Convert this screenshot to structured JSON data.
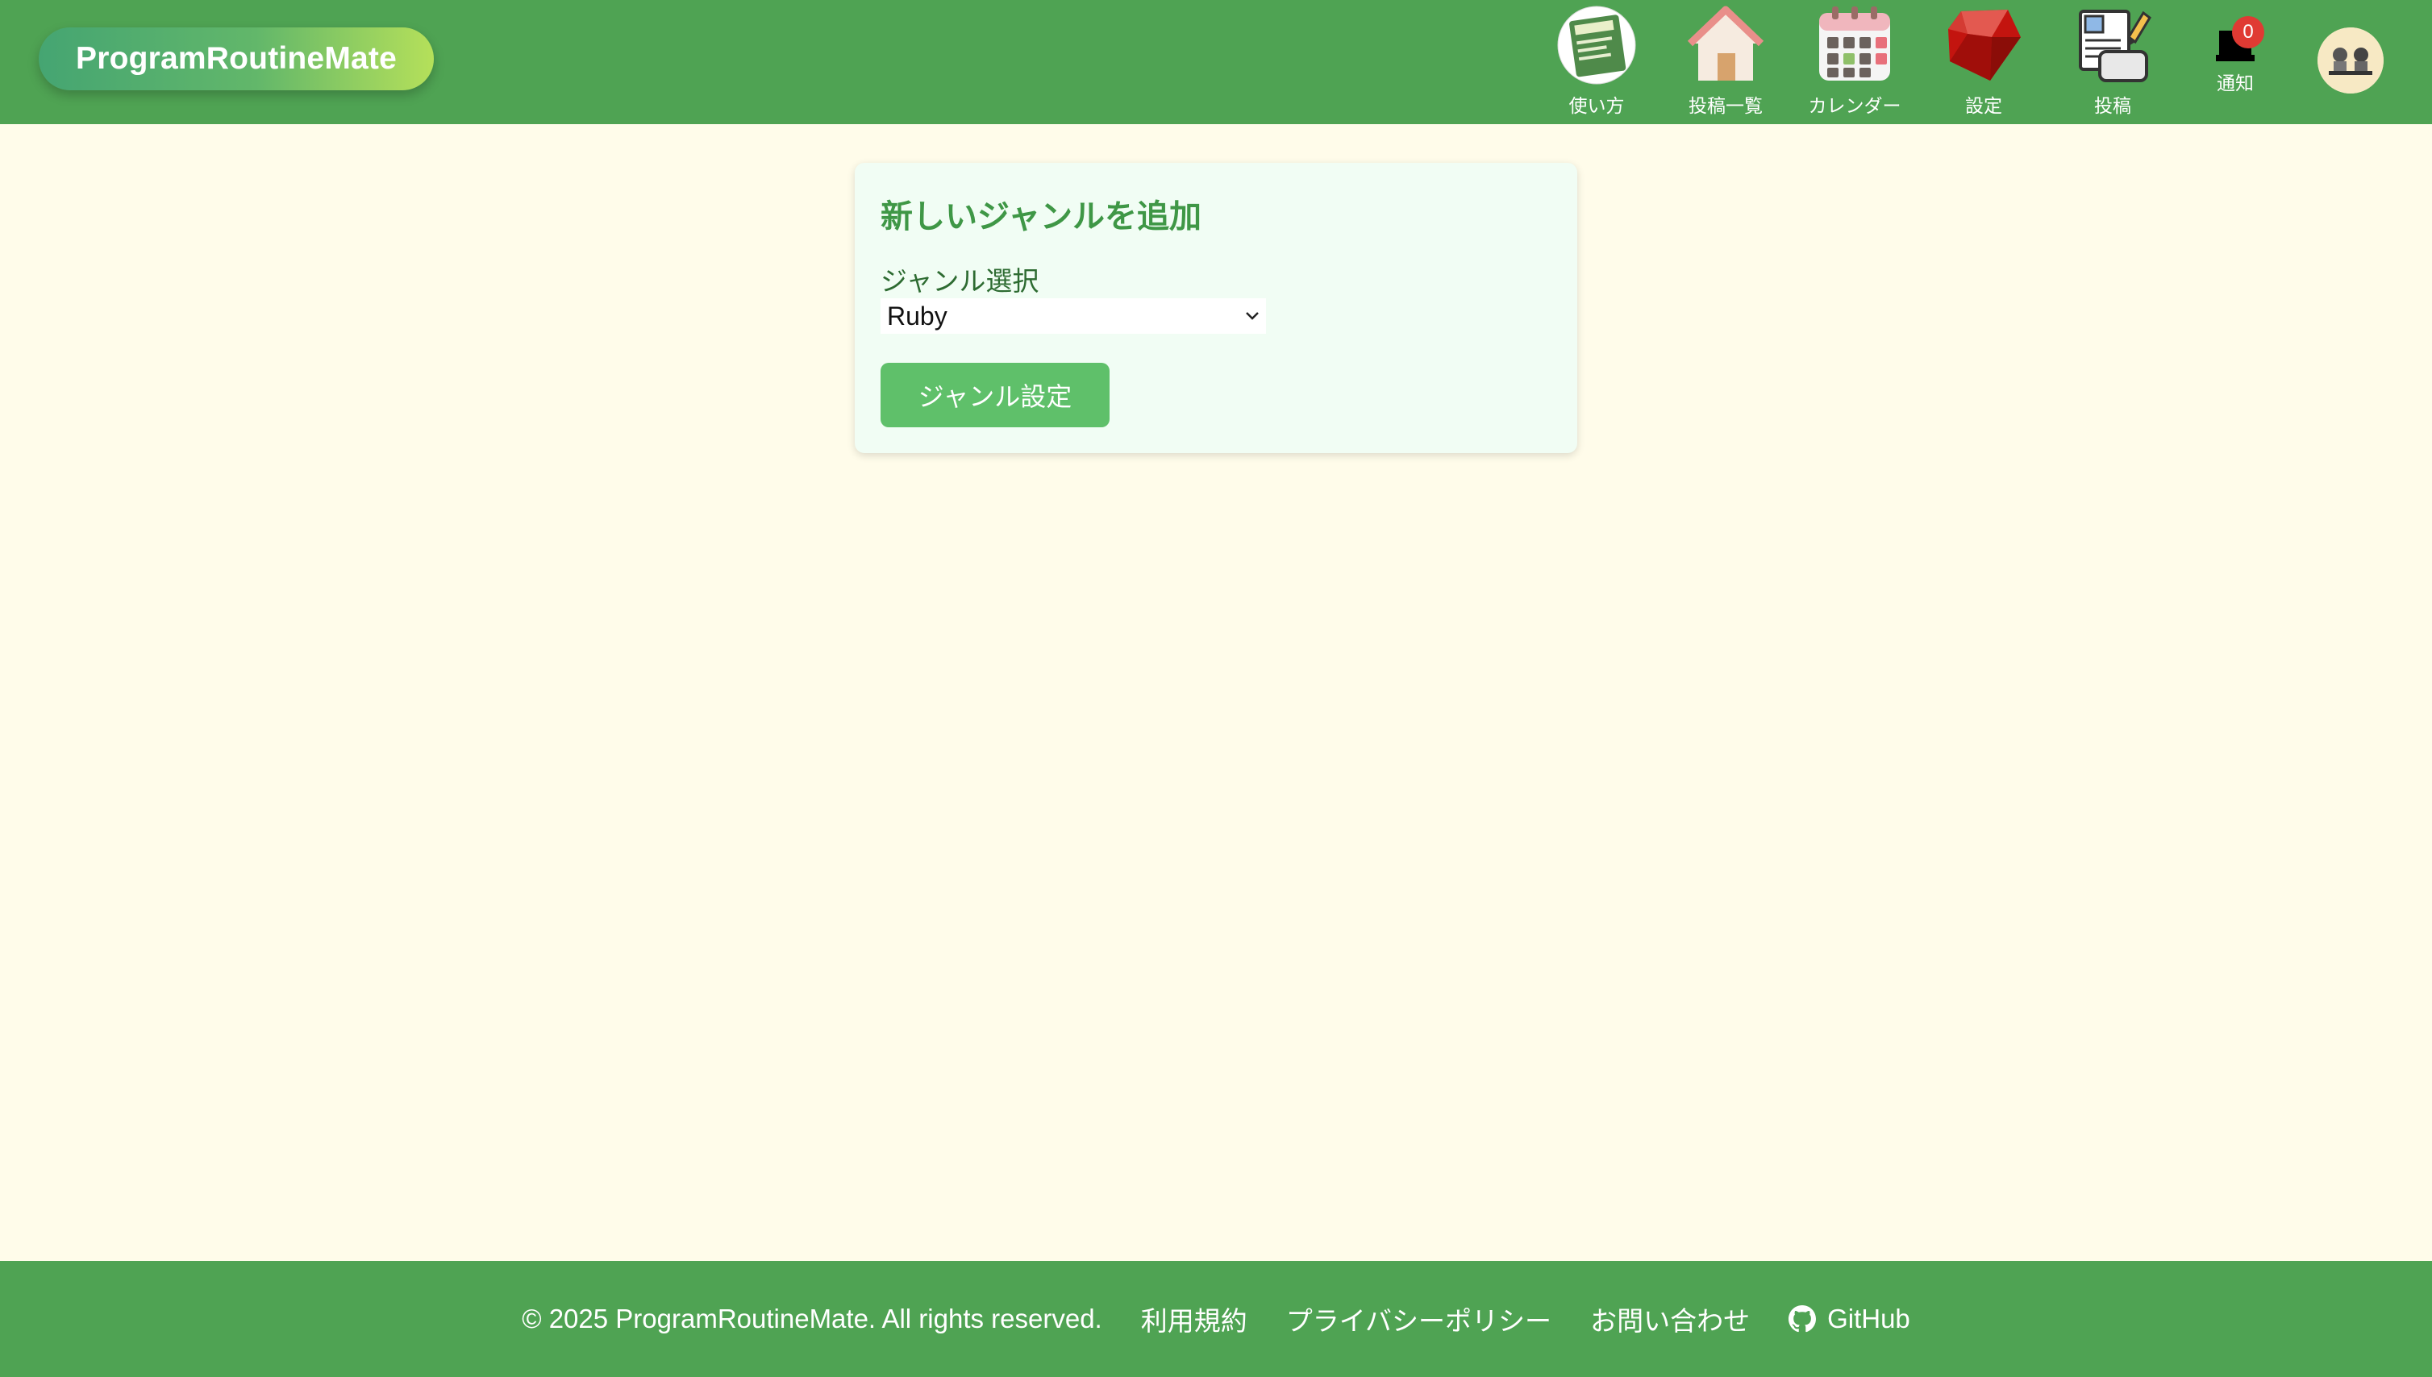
{
  "app": {
    "logo_text": "ProgramRoutineMate"
  },
  "nav": {
    "items": [
      {
        "label": "使い方",
        "icon": "guide-book-icon"
      },
      {
        "label": "投稿一覧",
        "icon": "house-icon"
      },
      {
        "label": "カレンダー",
        "icon": "calendar-icon"
      },
      {
        "label": "設定",
        "icon": "ruby-gem-icon"
      },
      {
        "label": "投稿",
        "icon": "post-edit-icon"
      }
    ],
    "notifications": {
      "label": "通知",
      "count": "0",
      "icon": "bell-icon"
    },
    "avatar": {
      "icon": "user-avatar-icon"
    }
  },
  "form": {
    "title": "新しいジャンルを追加",
    "genre_label": "ジャンル選択",
    "genre_selected": "Ruby",
    "submit_label": "ジャンル設定"
  },
  "footer": {
    "copyright": "© 2025 ProgramRoutineMate. All rights reserved.",
    "links": [
      "利用規約",
      "プライバシーポリシー",
      "お問い合わせ",
      "GitHub"
    ]
  },
  "colors": {
    "header_bg": "#4fa353",
    "page_bg": "#fffcea",
    "card_bg": "#f1fdf4",
    "title_green": "#3f9746",
    "button_green": "#5fc06a",
    "badge_red": "#e03a33"
  }
}
